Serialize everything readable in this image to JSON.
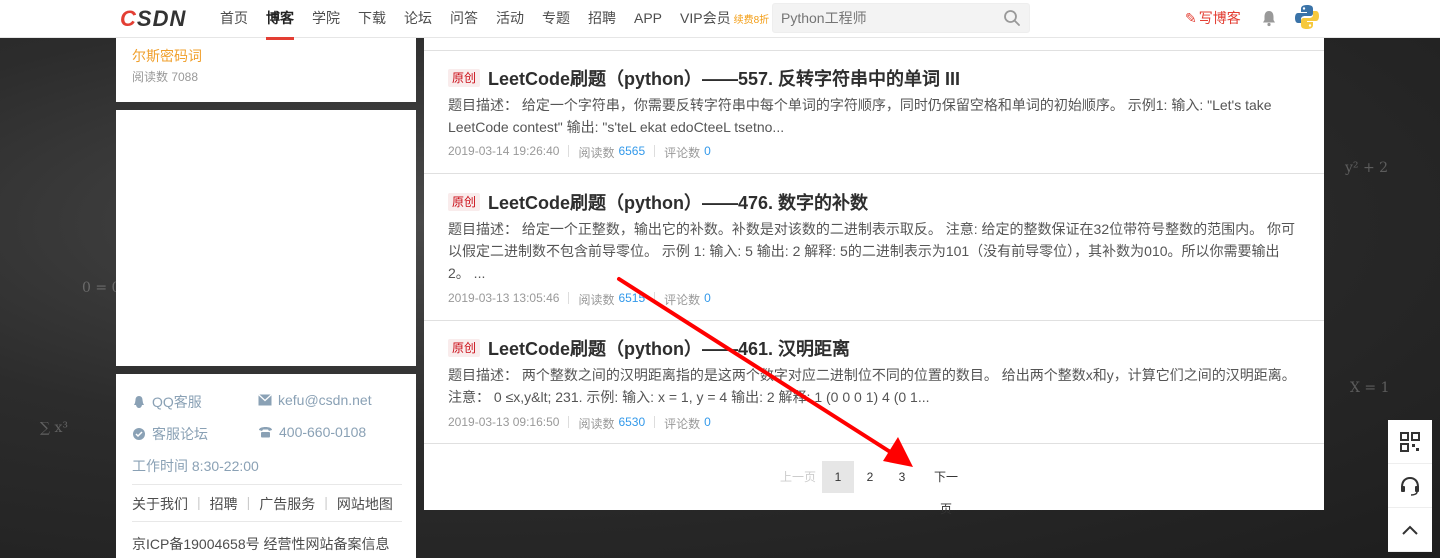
{
  "header": {
    "logo_c": "C",
    "logo_rest": "SDN",
    "nav": [
      "首页",
      "博客",
      "学院",
      "下载",
      "论坛",
      "问答",
      "活动",
      "专题",
      "招聘",
      "APP",
      "VIP会员"
    ],
    "vip_extra": "续费8折",
    "search_placeholder": "Python工程师",
    "write_label": "写博客",
    "accent_color": "#e33e33"
  },
  "sidebar": {
    "hot_article_title": "尔斯密码词",
    "hot_article_reads": "阅读数 7088",
    "contact": {
      "qq": "QQ客服",
      "email": "kefu@csdn.net",
      "forum": "客服论坛",
      "phone": "400-660-0108",
      "worktime": "工作时间 8:30-22:00"
    },
    "footer_links": [
      "关于我们",
      "招聘",
      "广告服务",
      "网站地图"
    ],
    "icp": "京ICP备19004658号  经营性网站备案信息"
  },
  "articles": [
    {
      "badge": "原创",
      "title": "LeetCode刷题（python）——557. 反转字符串中的单词 III",
      "desc": "题目描述： 给定一个字符串，你需要反转字符串中每个单词的字符顺序，同时仍保留空格和单词的初始顺序。 示例1: 输入: \"Let's take LeetCode contest\" 输出: \"s'teL ekat edoCteeL tsetno...",
      "date": "2019-03-14 19:26:40",
      "reads_label": "阅读数",
      "reads": "6565",
      "comments_label": "评论数",
      "comments": "0"
    },
    {
      "badge": "原创",
      "title": "LeetCode刷题（python）——476. 数字的补数",
      "desc": "题目描述： 给定一个正整数，输出它的补数。补数是对该数的二进制表示取反。 注意: 给定的整数保证在32位带符号整数的范围内。 你可以假定二进制数不包含前导零位。 示例 1: 输入: 5 输出: 2 解释: 5的二进制表示为101（没有前导零位），其补数为010。所以你需要输出2。 ...",
      "date": "2019-03-13 13:05:46",
      "reads_label": "阅读数",
      "reads": "6515",
      "comments_label": "评论数",
      "comments": "0"
    },
    {
      "badge": "原创",
      "title": "LeetCode刷题（python）——461. 汉明距离",
      "desc": "题目描述： 两个整数之间的汉明距离指的是这两个数字对应二进制位不同的位置的数目。 给出两个整数x和y，计算它们之间的汉明距离。 注意： 0 ≤x,y&lt; 231. 示例: 输入: x = 1, y = 4 输出: 2 解释: 1 (0 0 0 1) 4 (0 1...",
      "date": "2019-03-13 09:16:50",
      "reads_label": "阅读数",
      "reads": "6530",
      "comments_label": "评论数",
      "comments": "0"
    }
  ],
  "pagination": {
    "prev": "上一页",
    "pages": [
      "1",
      "2",
      "3"
    ],
    "current": "1",
    "next": "下一页"
  },
  "annotation": {
    "arrow_color": "#ff0000"
  }
}
